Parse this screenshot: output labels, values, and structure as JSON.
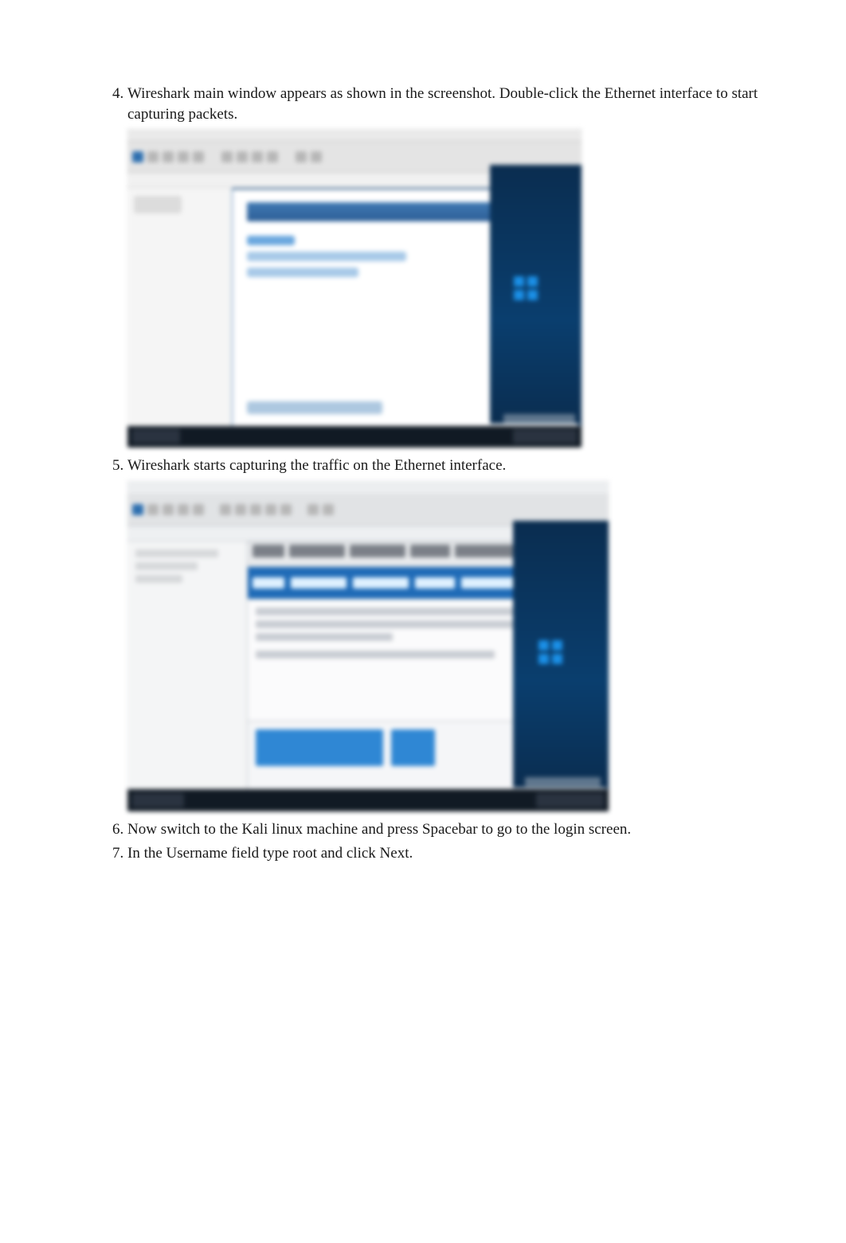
{
  "steps": [
    {
      "number": "4",
      "text": "Wireshark main window appears as shown in the screenshot. Double-click the Ethernet interface to start capturing packets."
    },
    {
      "number": "5",
      "text": "Wireshark starts capturing the traffic on the Ethernet interface."
    },
    {
      "number": "6",
      "text": "Now switch to the Kali linux machine and press Spacebar to go to the login screen."
    },
    {
      "number": "7",
      "text": "In the Username field type root and click Next."
    }
  ]
}
